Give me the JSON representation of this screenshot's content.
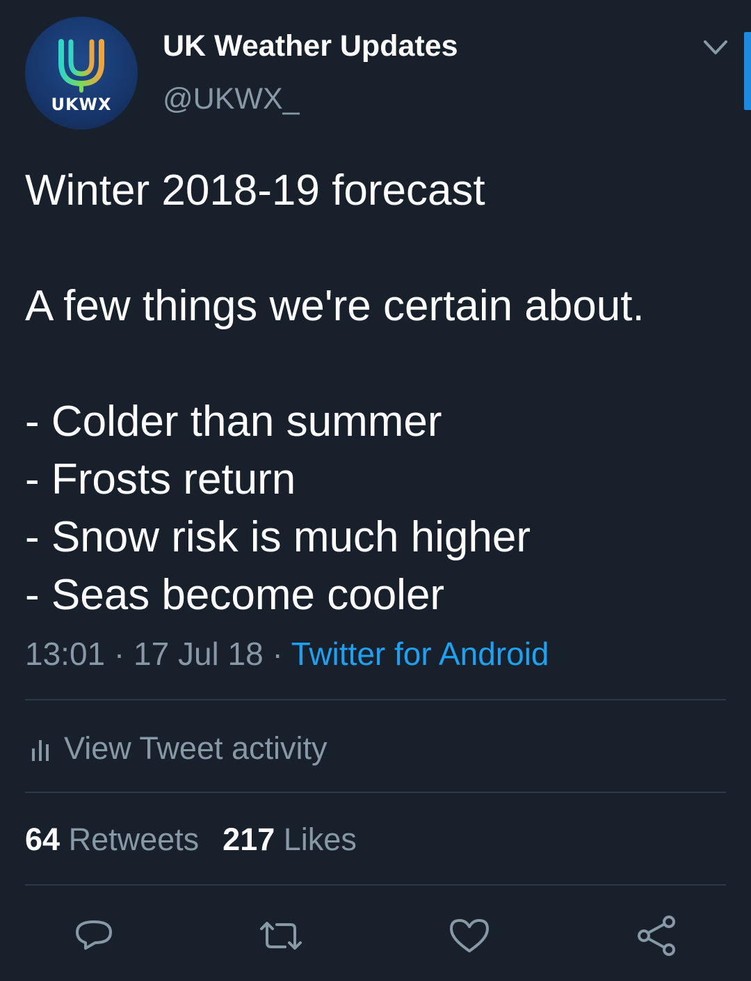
{
  "account": {
    "display_name": "UK Weather Updates",
    "handle": "@UKWX_",
    "avatar_text": "UKWX"
  },
  "tweet": {
    "lines": [
      "Winter 2018-19 forecast",
      "",
      "A few things we're certain about.",
      "",
      "- Colder than summer",
      "- Frosts return",
      "- Snow risk is much higher",
      "- Seas become cooler"
    ],
    "time": "13:01",
    "date": "17 Jul 18",
    "separator": " · ",
    "source": "Twitter for Android"
  },
  "activity": {
    "label": "View Tweet activity"
  },
  "stats": {
    "retweets_count": "64",
    "retweets_label": "Retweets",
    "likes_count": "217",
    "likes_label": "Likes"
  },
  "icons": {
    "chevron": "chevron-down-icon",
    "activity": "bar-chart-icon",
    "reply": "reply-icon",
    "retweet": "retweet-icon",
    "like": "heart-icon",
    "share": "share-icon"
  },
  "colors": {
    "background": "#18202b",
    "text_primary": "#ffffff",
    "text_secondary": "#8899a6",
    "link": "#1da1f2",
    "divider": "#2c3a48"
  }
}
